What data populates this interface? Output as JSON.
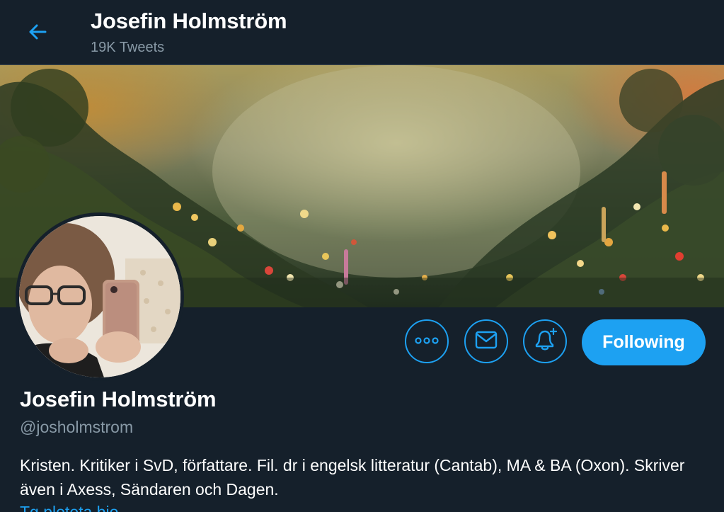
{
  "header": {
    "back_icon": "arrow-left-icon",
    "title": "Josefin Holmström",
    "subtitle": "19K Tweets"
  },
  "profile": {
    "name": "Josefin Holmström",
    "handle": "@josholmstrom",
    "bio": "Kristen. Kritiker i SvD, författare. Fil. dr i engelsk litteratur (Cantab), MA & BA (Oxon). Skriver även i Axess, Sändaren och Dagen.",
    "link_partial": "Tg.ploteta.bio"
  },
  "actions": {
    "more_icon": "more-dots-icon",
    "message_icon": "envelope-icon",
    "notify_icon": "bell-plus-icon",
    "follow_label": "Following"
  },
  "colors": {
    "background": "#15202b",
    "accent": "#1da1f2",
    "muted_text": "#8899a6",
    "border": "#38444d"
  }
}
